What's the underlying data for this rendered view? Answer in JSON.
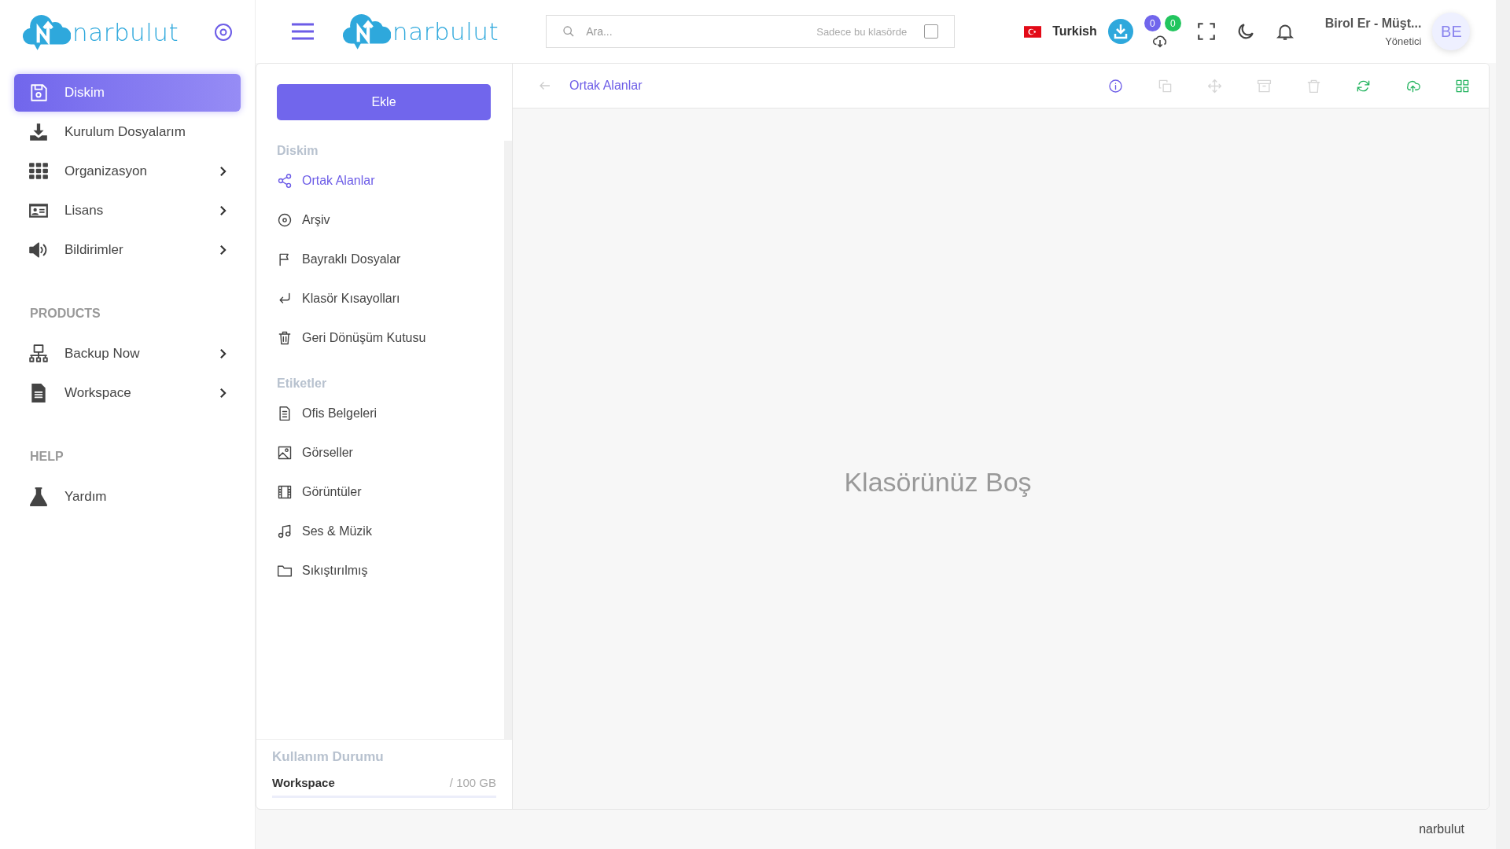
{
  "sidebar": {
    "logo": "narbulut",
    "items": [
      {
        "label": "Diskim",
        "selected": true,
        "submenu": false
      },
      {
        "label": "Kurulum Dosyalarım",
        "selected": false,
        "submenu": false
      },
      {
        "label": "Organizasyon",
        "selected": false,
        "submenu": true
      },
      {
        "label": "Lisans",
        "selected": false,
        "submenu": true
      },
      {
        "label": "Bildirimler",
        "selected": false,
        "submenu": true
      }
    ],
    "sections": [
      {
        "title": "PRODUCTS",
        "items": [
          {
            "label": "Backup Now",
            "selected": false,
            "submenu": true
          },
          {
            "label": "Workspace",
            "selected": false,
            "submenu": true
          }
        ]
      },
      {
        "title": "HELP",
        "items": [
          {
            "label": "Yardım",
            "selected": false,
            "submenu": false
          }
        ]
      }
    ]
  },
  "header": {
    "logo": "narbulut",
    "search": {
      "placeholder": "Ara...",
      "scope_label": "Sadece bu klasörde",
      "checked": false
    },
    "language": "Turkish",
    "upload_count": "0",
    "download_count": "0",
    "user": {
      "name": "Birol Er - Müşt...",
      "role": "Yönetici",
      "initials": "BE"
    }
  },
  "panel": {
    "add_button": "Ekle",
    "groups": [
      {
        "title": "Diskim",
        "items": [
          {
            "label": "Ortak Alanlar",
            "selected": true
          },
          {
            "label": "Arşiv",
            "selected": false
          },
          {
            "label": "Bayraklı Dosyalar",
            "selected": false
          },
          {
            "label": "Klasör Kısayolları",
            "selected": false
          },
          {
            "label": "Geri Dönüşüm Kutusu",
            "selected": false
          }
        ]
      },
      {
        "title": "Etiketler",
        "items": [
          {
            "label": "Ofis Belgeleri",
            "selected": false
          },
          {
            "label": "Görseller",
            "selected": false
          },
          {
            "label": "Görüntüler",
            "selected": false
          },
          {
            "label": "Ses & Müzik",
            "selected": false
          },
          {
            "label": "Sıkıştırılmış",
            "selected": false
          }
        ]
      }
    ],
    "usage": {
      "title": "Kullanım Durumu",
      "label": "Workspace",
      "value": "/ 100 GB"
    }
  },
  "toolbar": {
    "path": "Ortak Alanlar",
    "actions": [
      {
        "disabled": false
      },
      {
        "disabled": true
      },
      {
        "disabled": true
      },
      {
        "disabled": true
      },
      {
        "disabled": true
      },
      {
        "disabled": false
      },
      {
        "disabled": false
      },
      {
        "disabled": false
      }
    ]
  },
  "empty_message": "Klasörünüz Boş",
  "footer": "narbulut"
}
